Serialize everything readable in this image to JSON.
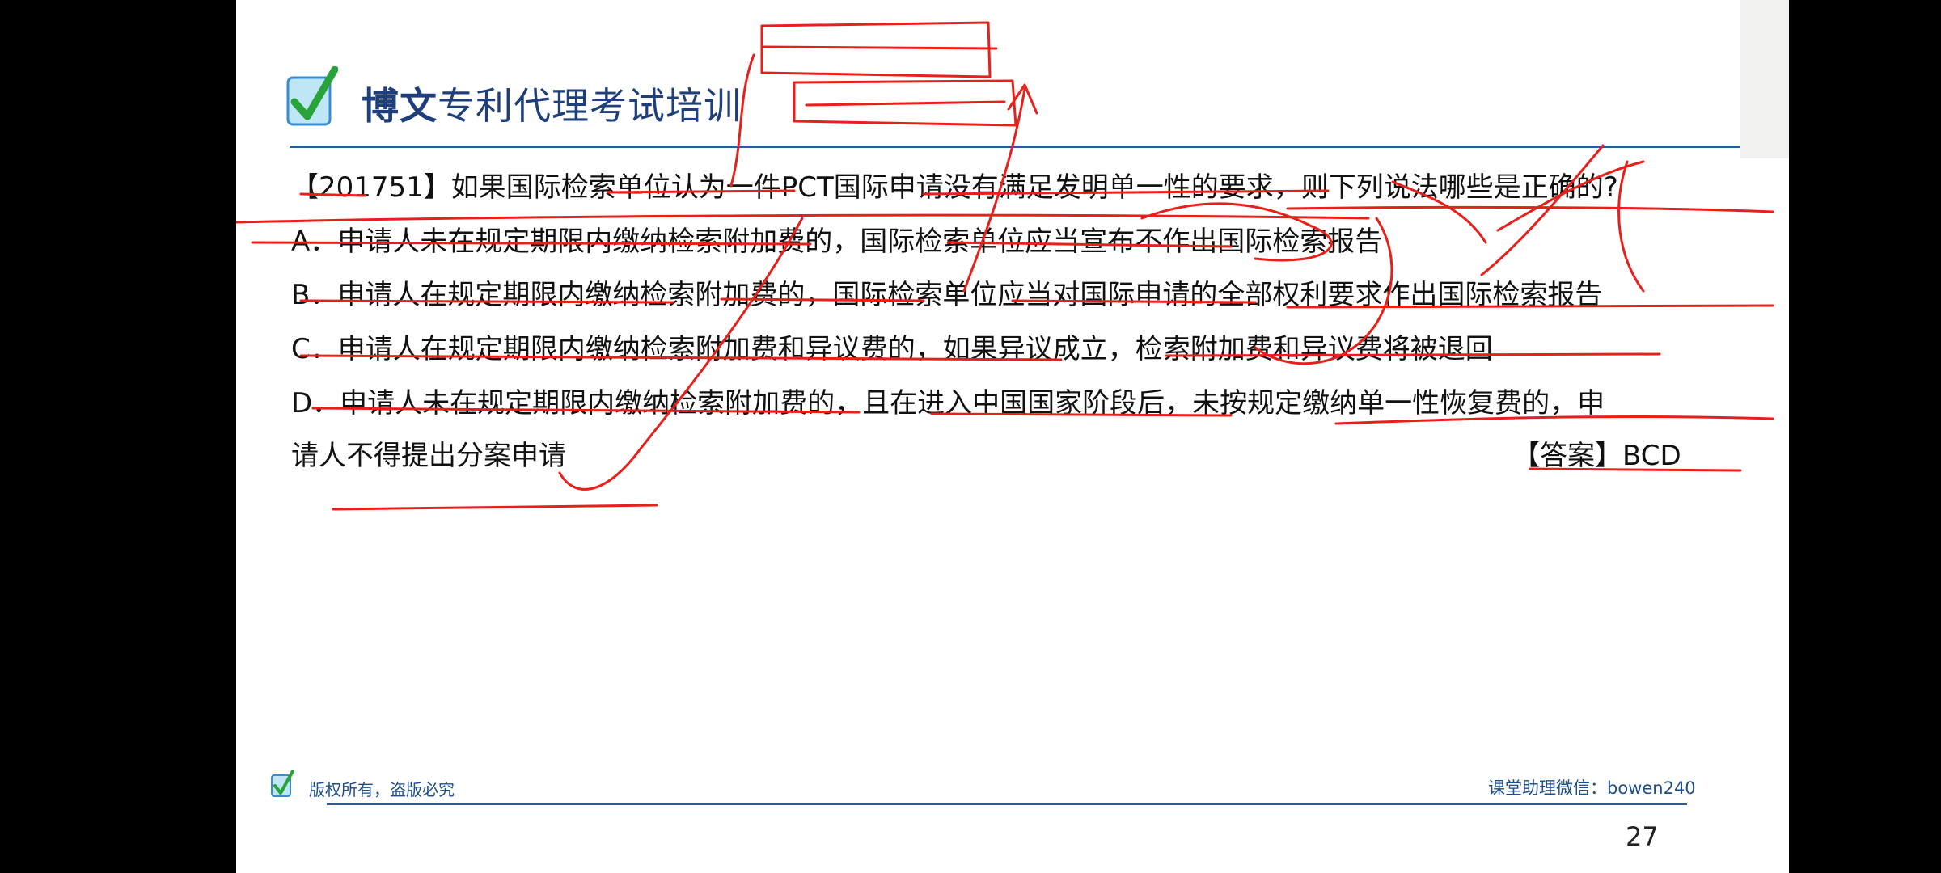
{
  "brand": {
    "bold": "博文",
    "rest": "专利代理考试培训"
  },
  "question": {
    "line1": "【201751】如果国际检索单位认为一件PCT国际申请没有满足发明单一性的要求，则下列说法哪些是正确的?",
    "optionA": "A．申请人未在规定期限内缴纳检索附加费的，国际检索单位应当宣布不作出国际检索报告",
    "optionB": "B．申请人在规定期限内缴纳检索附加费的，国际检索单位应当对国际申请的全部权利要求作出国际检索报告",
    "optionC": "C．申请人在规定期限内缴纳检索附加费和异议费的，如果异议成立，检索附加费和异议费将被退回",
    "optionD1": "D．申请人未在规定期限内缴纳检索附加费的，且在进入中国国家阶段后，未按规定缴纳单一性恢复费的，申",
    "optionD2": "请人不得提出分案申请"
  },
  "answer": "【答案】BCD",
  "footer": {
    "copyright": "版权所有，盗版必究",
    "assistant": "课堂助理微信：bowen240"
  },
  "page_number": "27",
  "colors": {
    "ink": "#e8201b",
    "brand": "#1f3f7a",
    "rule": "#2a5c95"
  }
}
